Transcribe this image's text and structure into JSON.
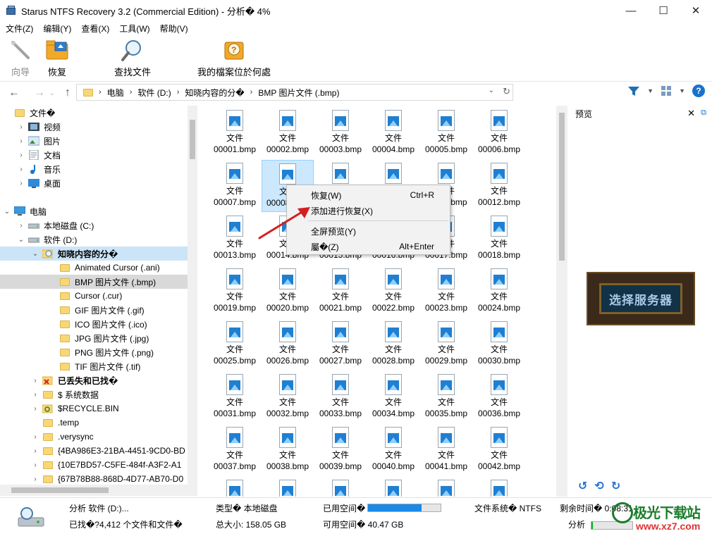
{
  "window": {
    "title": "Starus NTFS Recovery 3.2 (Commercial Edition) - 分析� 4%",
    "min": "—",
    "max": "☐",
    "close": "✕"
  },
  "menu": [
    "文件(Z)",
    "编辑(Y)",
    "查看(X)",
    "工具(W)",
    "帮助(V)"
  ],
  "toolbar": {
    "wizard": "向导",
    "recover": "恢复",
    "find": "查找文件",
    "where": "我的檔案位於何處"
  },
  "address": {
    "crumbs": [
      "电脑",
      "软件 (D:)",
      "知晓内容的分�",
      "BMP 图片文件 (.bmp)"
    ]
  },
  "tree": [
    {
      "label": "文件�",
      "level": 0,
      "icon": "folder",
      "exp": ""
    },
    {
      "label": "视频",
      "level": 1,
      "icon": "video",
      "exp": "›"
    },
    {
      "label": "图片",
      "level": 1,
      "icon": "picture",
      "exp": "›"
    },
    {
      "label": "文档",
      "level": 1,
      "icon": "document",
      "exp": "›"
    },
    {
      "label": "音乐",
      "level": 1,
      "icon": "music",
      "exp": "›"
    },
    {
      "label": "桌面",
      "level": 1,
      "icon": "desktop",
      "exp": "›"
    },
    {
      "label": "",
      "level": 0,
      "icon": "none",
      "exp": ""
    },
    {
      "label": "电脑",
      "level": 0,
      "icon": "computer",
      "exp": "⌄"
    },
    {
      "label": "本地磁盘 (C:)",
      "level": 1,
      "icon": "drive",
      "exp": "›"
    },
    {
      "label": "软件 (D:)",
      "level": 1,
      "icon": "drive",
      "exp": "⌄"
    },
    {
      "label": "知晓内容的分�",
      "level": 2,
      "icon": "search-folder",
      "exp": "⌄",
      "bold": true,
      "sel": true
    },
    {
      "label": "Animated Cursor (.ani)",
      "level": 3,
      "icon": "folder",
      "exp": ""
    },
    {
      "label": "BMP 图片文件 (.bmp)",
      "level": 3,
      "icon": "folder",
      "exp": "",
      "selgray": true
    },
    {
      "label": "Cursor (.cur)",
      "level": 3,
      "icon": "folder",
      "exp": ""
    },
    {
      "label": "GIF 图片文件 (.gif)",
      "level": 3,
      "icon": "folder",
      "exp": ""
    },
    {
      "label": "ICO 图片文件 (.ico)",
      "level": 3,
      "icon": "folder",
      "exp": ""
    },
    {
      "label": "JPG 图片文件 (.jpg)",
      "level": 3,
      "icon": "folder",
      "exp": ""
    },
    {
      "label": "PNG 图片文件 (.png)",
      "level": 3,
      "icon": "folder",
      "exp": ""
    },
    {
      "label": "TIF 图片文件 (.tif)",
      "level": 3,
      "icon": "folder",
      "exp": ""
    },
    {
      "label": "已丢失和已找�",
      "level": 2,
      "icon": "lost-folder",
      "exp": "›",
      "bold": true
    },
    {
      "label": "$ 系统数据",
      "level": 2,
      "icon": "folder",
      "exp": "›"
    },
    {
      "label": "$RECYCLE.BIN",
      "level": 2,
      "icon": "recycle-folder",
      "exp": "›"
    },
    {
      "label": ".temp",
      "level": 2,
      "icon": "folder",
      "exp": ""
    },
    {
      "label": ".verysync",
      "level": 2,
      "icon": "folder",
      "exp": "›"
    },
    {
      "label": "{4BA986E3-21BA-4451-9CD0-BD",
      "level": 2,
      "icon": "folder",
      "exp": "›"
    },
    {
      "label": "{10E7BD57-C5FE-484f-A3F2-A1",
      "level": 2,
      "icon": "folder",
      "exp": "›"
    },
    {
      "label": "{67B78B88-868D-4D77-AB70-D0",
      "level": 2,
      "icon": "folder",
      "exp": "›"
    }
  ],
  "files": {
    "label_top": "文件",
    "names": [
      "00001.bmp",
      "00002.bmp",
      "00003.bmp",
      "00004.bmp",
      "00005.bmp",
      "00006.bmp",
      "00007.bmp",
      "00008.bmp",
      "00009.bmp",
      "00010.bmp",
      "00011.bmp",
      "00012.bmp",
      "00013.bmp",
      "00014.bmp",
      "00015.bmp",
      "00016.bmp",
      "00017.bmp",
      "00018.bmp",
      "00019.bmp",
      "00020.bmp",
      "00021.bmp",
      "00022.bmp",
      "00023.bmp",
      "00024.bmp",
      "00025.bmp",
      "00026.bmp",
      "00027.bmp",
      "00028.bmp",
      "00029.bmp",
      "00030.bmp",
      "00031.bmp",
      "00032.bmp",
      "00033.bmp",
      "00034.bmp",
      "00035.bmp",
      "00036.bmp",
      "00037.bmp",
      "00038.bmp",
      "00039.bmp",
      "00040.bmp",
      "00041.bmp",
      "00042.bmp",
      "",
      "",
      "",
      "",
      "",
      ""
    ],
    "selected_index": 7
  },
  "context_menu": {
    "items": [
      {
        "label": "恢复(W)",
        "shortcut": "Ctrl+R"
      },
      {
        "label": "添加进行恢复(X)",
        "shortcut": ""
      },
      {
        "label": "全屏预览(Y)",
        "shortcut": ""
      },
      {
        "label": "屬�(Z)",
        "shortcut": "Alt+Enter"
      }
    ]
  },
  "preview": {
    "title": "预览",
    "image_text": "选择服务器"
  },
  "status": {
    "analysis": "分析 软件 (D:)...",
    "found": "已找�?4,412 个文件和文件�",
    "type_label": "类型� 本地磁盘",
    "total_label": "总大小: 158.05 GB",
    "used_label": "已用空间�",
    "used_fraction": 0.74,
    "free_label": "可用空间� 40.47 GB",
    "fs_label": "文件系统� NTFS",
    "remaining_label": "剩余时间� 0:08:31",
    "progress_label": "分析",
    "progress_fraction": 0.04
  },
  "watermark": {
    "text": "极光下载站",
    "url": "www.xz7.com"
  },
  "colors": {
    "accent": "#1a8ae6",
    "selection": "#cce8ff",
    "tree_selection": "#cce4f7",
    "folder": "#f8d775"
  }
}
